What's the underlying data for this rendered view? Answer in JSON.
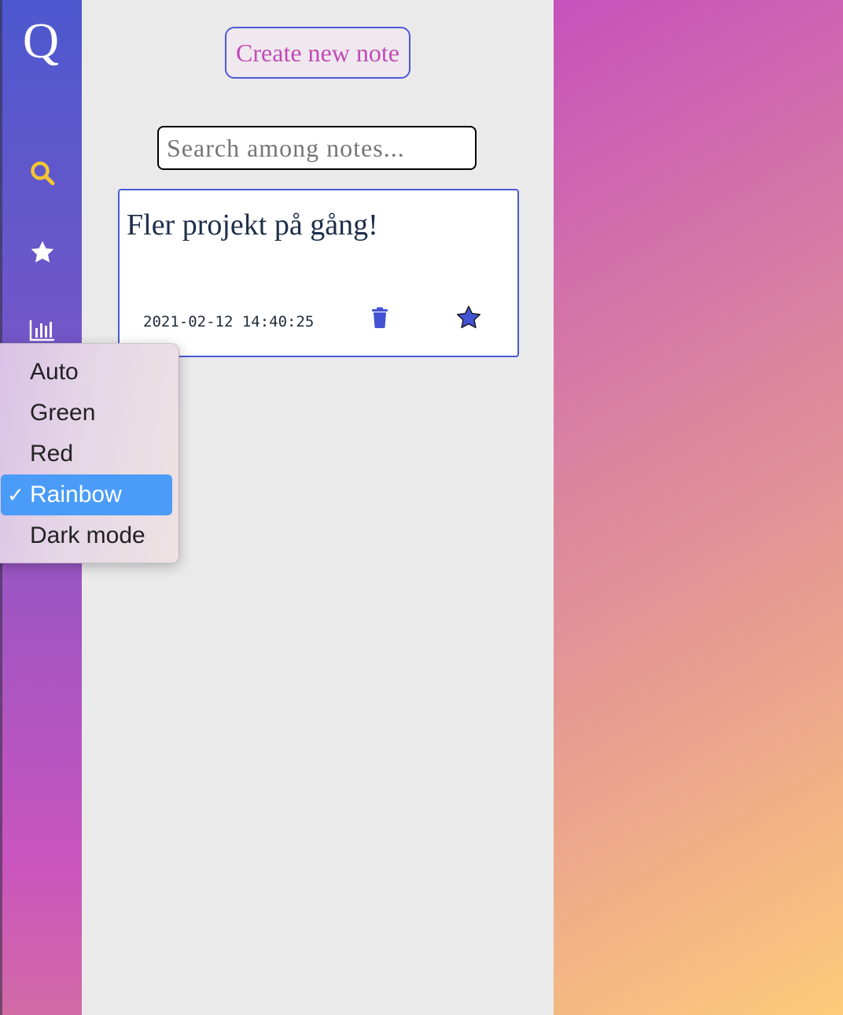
{
  "app": {
    "logo_letter": "Q"
  },
  "sidebar": {
    "items": [
      {
        "name": "search",
        "icon": "search-icon",
        "color": "#f4c531"
      },
      {
        "name": "favorites",
        "icon": "star-icon",
        "color": "#ffffff"
      },
      {
        "name": "statistics",
        "icon": "bar-chart-icon",
        "color": "#ffffff"
      }
    ]
  },
  "toolbar": {
    "create_label": "Create new note"
  },
  "search": {
    "placeholder": "Search among notes..."
  },
  "notes": [
    {
      "title": "Fler projekt på gång!",
      "timestamp": "2021-02-12 14:40:25",
      "favorited": true
    }
  ],
  "theme_menu": {
    "options": [
      "Auto",
      "Green",
      "Red",
      "Rainbow",
      "Dark mode"
    ],
    "selected": "Rainbow",
    "check_glyph": "✓"
  },
  "colors": {
    "accent": "#4b5bd6",
    "brand_pink": "#c14bb8",
    "selection": "#4a9cf8"
  }
}
